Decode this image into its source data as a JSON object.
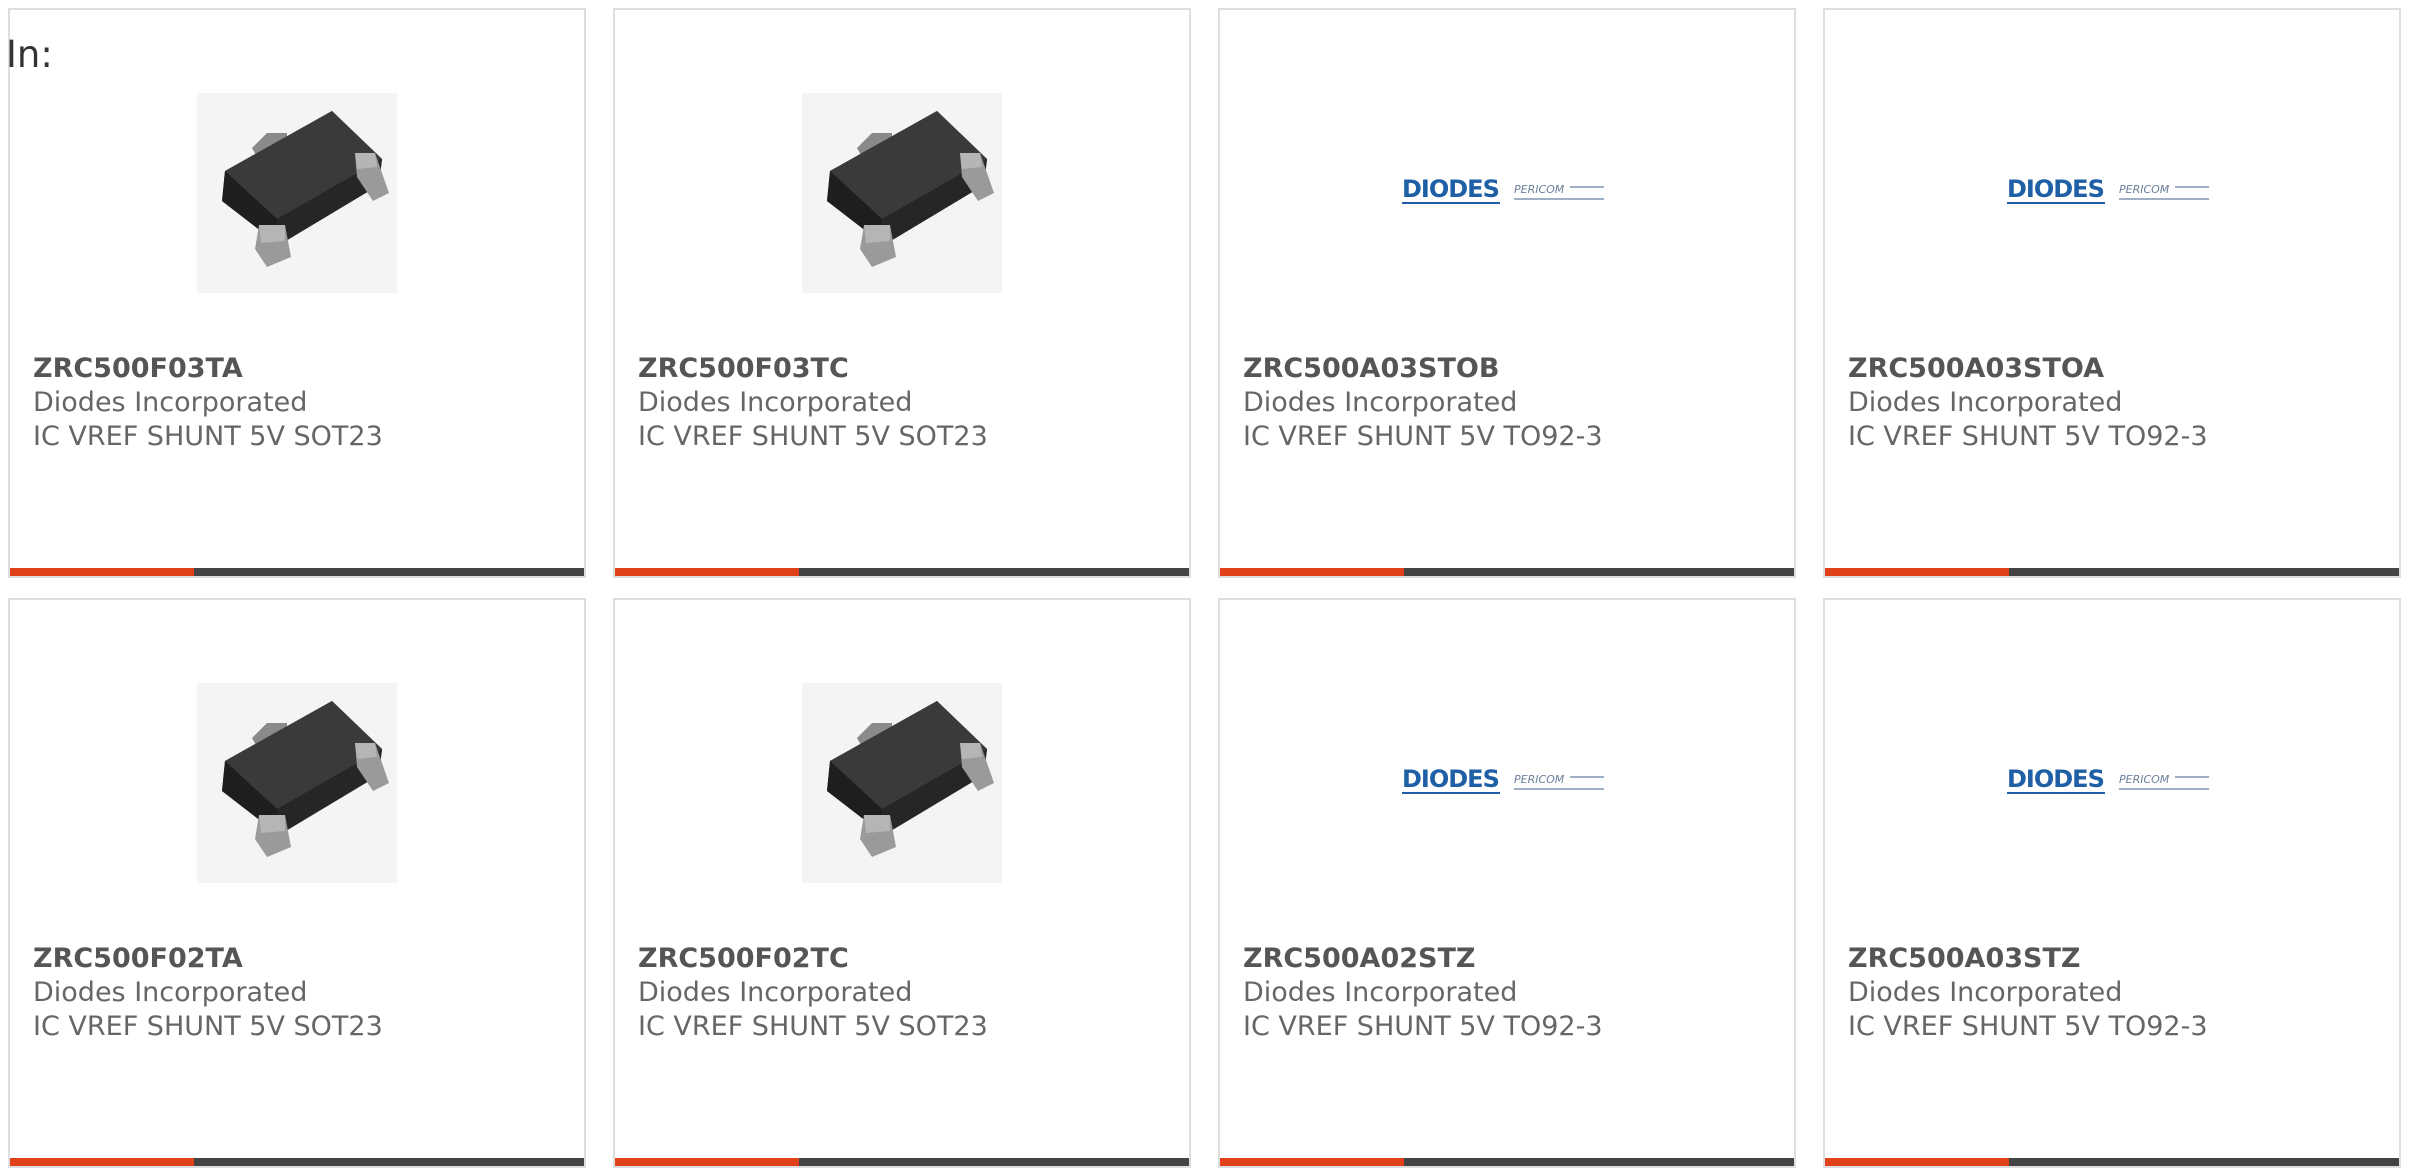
{
  "heading": "In:",
  "colors": {
    "accent": "#e0401a",
    "bar_track": "#444444",
    "card_border": "#dedede",
    "part_text": "#555555",
    "detail_text": "#666666",
    "diodes_blue": "#1e5fa6"
  },
  "cards": [
    {
      "part_number": "ZRC500F03TA",
      "manufacturer": "Diodes Incorporated",
      "description": "IC VREF SHUNT 5V SOT23",
      "image": "sot23-package-icon",
      "bar_fill": 0.32
    },
    {
      "part_number": "ZRC500F03TC",
      "manufacturer": "Diodes Incorporated",
      "description": "IC VREF SHUNT 5V SOT23",
      "image": "sot23-package-icon",
      "bar_fill": 0.32
    },
    {
      "part_number": "ZRC500A03STOB",
      "manufacturer": "Diodes Incorporated",
      "description": "IC VREF SHUNT 5V TO92-3",
      "image": "diodes-pericom-logo",
      "bar_fill": 0.32,
      "logo_text": "DIODES",
      "logo_sub": "PERICOM"
    },
    {
      "part_number": "ZRC500A03STOA",
      "manufacturer": "Diodes Incorporated",
      "description": "IC VREF SHUNT 5V TO92-3",
      "image": "diodes-pericom-logo",
      "bar_fill": 0.32,
      "logo_text": "DIODES",
      "logo_sub": "PERICOM"
    },
    {
      "part_number": "ZRC500F02TA",
      "manufacturer": "Diodes Incorporated",
      "description": "IC VREF SHUNT 5V SOT23",
      "image": "sot23-package-icon",
      "bar_fill": 0.32
    },
    {
      "part_number": "ZRC500F02TC",
      "manufacturer": "Diodes Incorporated",
      "description": "IC VREF SHUNT 5V SOT23",
      "image": "sot23-package-icon",
      "bar_fill": 0.32
    },
    {
      "part_number": "ZRC500A02STZ",
      "manufacturer": "Diodes Incorporated",
      "description": "IC VREF SHUNT 5V TO92-3",
      "image": "diodes-pericom-logo",
      "bar_fill": 0.32,
      "logo_text": "DIODES",
      "logo_sub": "PERICOM"
    },
    {
      "part_number": "ZRC500A03STZ",
      "manufacturer": "Diodes Incorporated",
      "description": "IC VREF SHUNT 5V TO92-3",
      "image": "diodes-pericom-logo",
      "bar_fill": 0.32,
      "logo_text": "DIODES",
      "logo_sub": "PERICOM"
    }
  ]
}
